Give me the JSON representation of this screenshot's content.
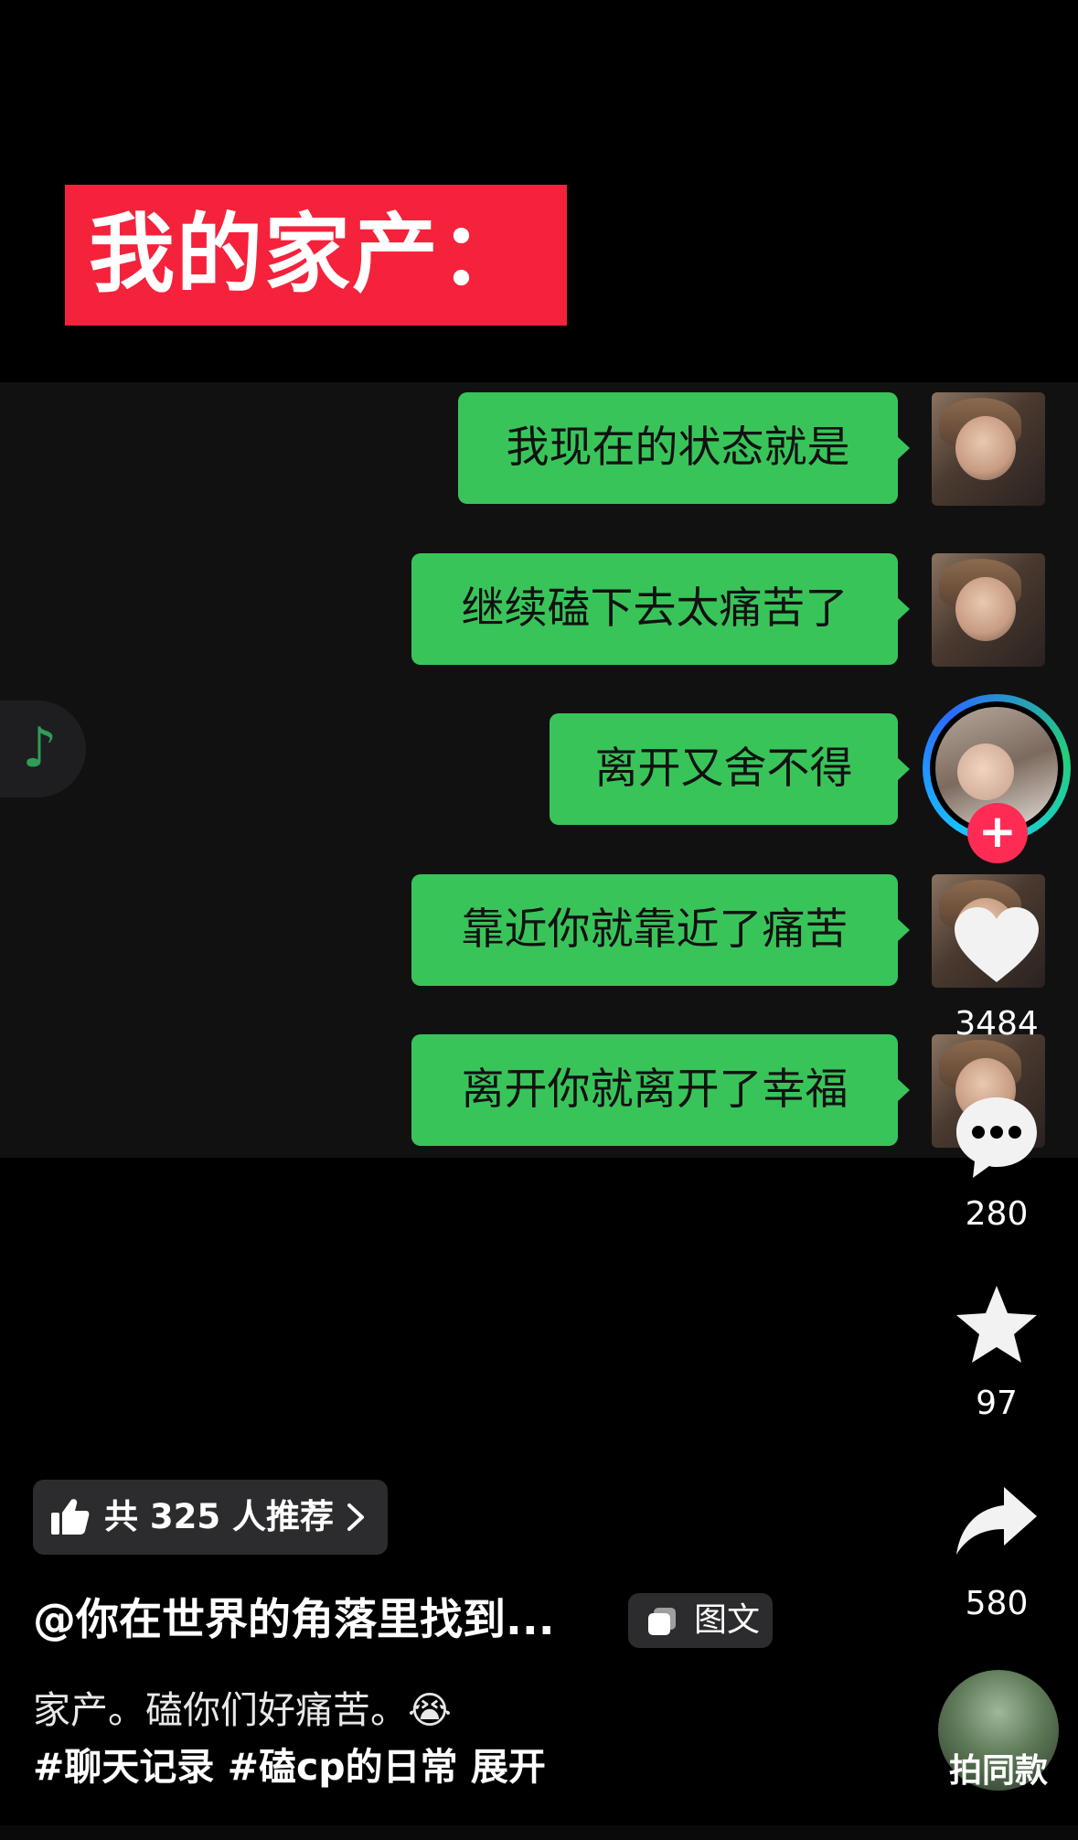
{
  "title_banner": {
    "text": "我的家产："
  },
  "messages": [
    {
      "text": "我现在的状态就是"
    },
    {
      "text": "继续磕下去太痛苦了"
    },
    {
      "text": "离开又舍不得"
    },
    {
      "text": "靠近你就靠近了痛苦"
    },
    {
      "text": "离开你就离开了幸福"
    }
  ],
  "actions": {
    "like_count": "3484",
    "comment_count": "280",
    "favorite_count": "97",
    "share_count": "580"
  },
  "recommend": {
    "label": "共 325 人推荐"
  },
  "author": {
    "handle": "@你在世界的角落里找到..."
  },
  "tuwen": {
    "label": "图文"
  },
  "caption": {
    "line1": "家产。磕你们好痛苦。😭",
    "line2": "#聊天记录 #磕cp的日常  展开"
  },
  "music": {
    "label": "拍同款"
  },
  "colors": {
    "bubble": "#39c45a",
    "banner": "#f5223b",
    "follow": "#fe2c55",
    "accent_note": "#2f9d56"
  }
}
